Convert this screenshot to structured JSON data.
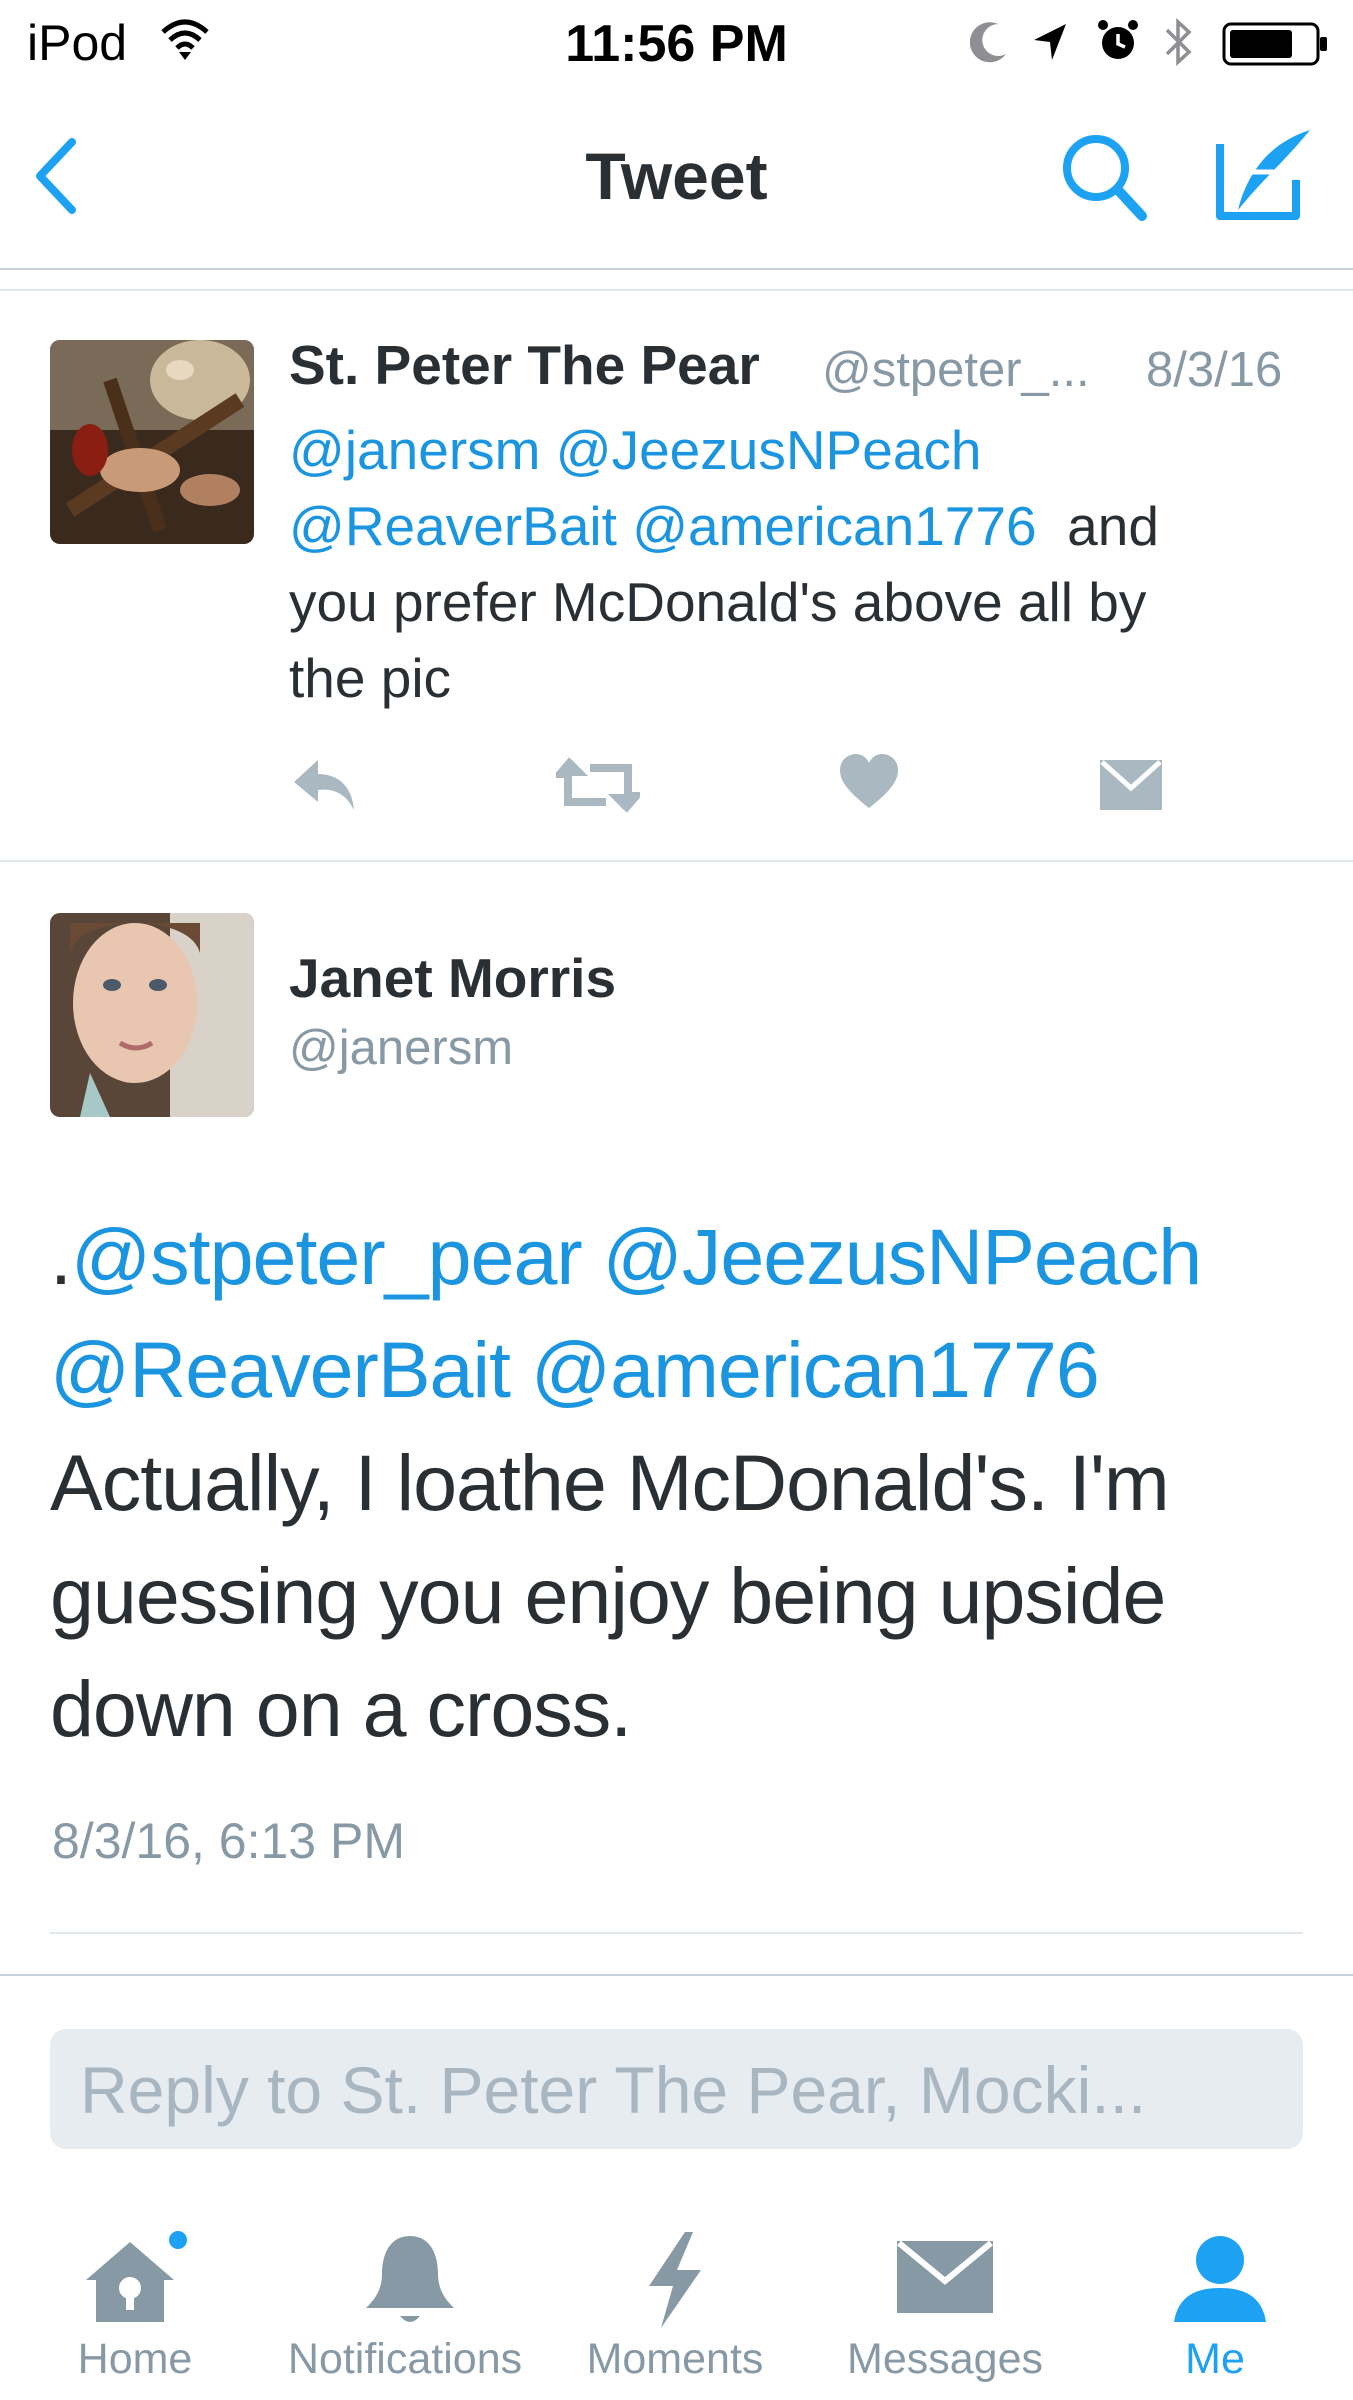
{
  "status_bar": {
    "carrier": "iPod",
    "time": "11:56 PM",
    "icons": [
      "wifi-icon",
      "moon-icon",
      "location-arrow-icon",
      "alarm-icon",
      "bluetooth-icon",
      "battery-icon"
    ]
  },
  "nav": {
    "back_icon": "chevron-left-icon",
    "title": "Tweet",
    "search_icon": "search-icon",
    "compose_icon": "compose-icon"
  },
  "quoted_tweet": {
    "name": "St. Peter The Pear",
    "handle": "@stpeter_...",
    "date": "8/3/16",
    "text": {
      "line1_mention1": "@janersm",
      "line1_mention2": "@JeezusNPeach",
      "line2_mention1": "@ReaverBait",
      "line2_mention2": "@american1776",
      "line2_text": "and",
      "line3": "you prefer McDonald's above all by",
      "line4": "the pic"
    },
    "actions": [
      "reply-icon",
      "retweet-icon",
      "like-icon",
      "dm-icon"
    ]
  },
  "main_tweet": {
    "name": "Janet Morris",
    "handle": "@janersm",
    "text": {
      "line1_prefix": ".",
      "line1_mention1": "@stpeter_pear",
      "line1_mention2": "@JeezusNPeach",
      "line2_mention1": "@ReaverBait",
      "line2_mention2": "@american1776",
      "line3": "Actually, I loathe McDonald's. I'm",
      "line4": "guessing you enjoy being upside",
      "line5": "down on a cross."
    },
    "timestamp": "8/3/16, 6:13 PM"
  },
  "reply": {
    "placeholder": "Reply to St. Peter The Pear, Mocki..."
  },
  "tab_bar": {
    "home": "Home",
    "notifications": "Notifications",
    "moments": "Moments",
    "messages": "Messages",
    "me": "Me",
    "active": "me"
  },
  "colors": {
    "accent": "#1da1f2",
    "mention": "#1b95e0",
    "text": "#292f33",
    "secondary": "#8899a6",
    "icon_gray": "#aab8c2"
  }
}
